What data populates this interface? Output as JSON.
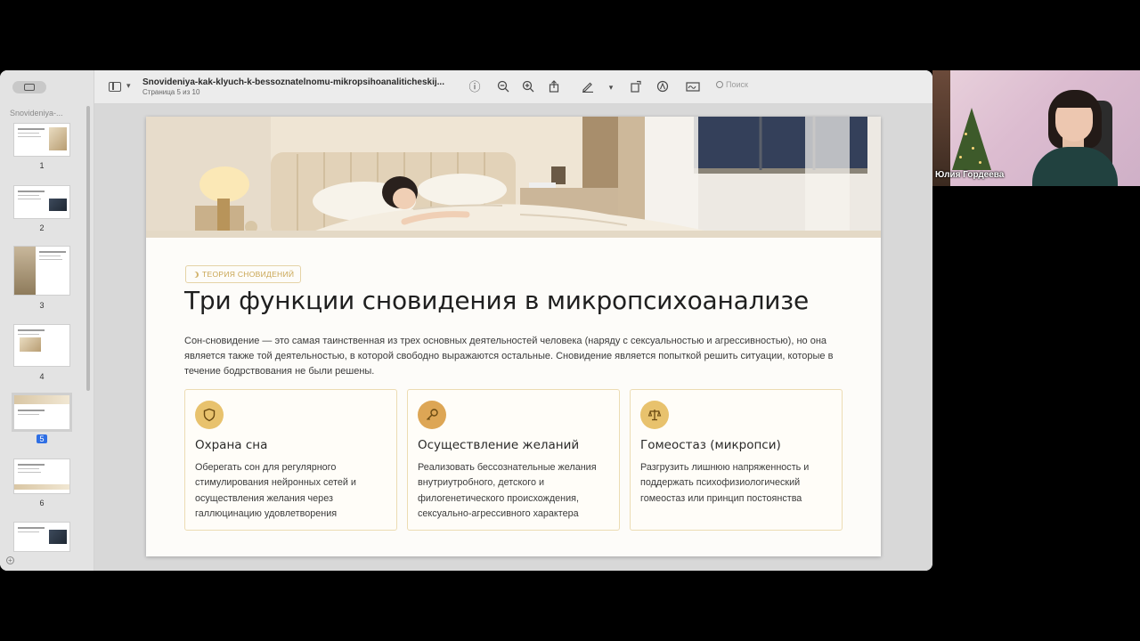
{
  "document": {
    "file_name": "Snovideniya-kak-klyuch-k-bessoznatelnomu-mikropsihoanaliticheskij...",
    "page_indicator": "Страница 5 из 10",
    "sidebar_title": "Snovideniya-..."
  },
  "toolbar": {
    "search_placeholder": "Поиск",
    "icons": [
      "sidebar-icon",
      "info-icon",
      "zoom-out-icon",
      "zoom-in-icon",
      "share-icon",
      "markup-pen-icon",
      "rotate-icon",
      "highlight-icon",
      "signature-icon",
      "search-icon"
    ]
  },
  "thumbnails": [
    {
      "page": "1"
    },
    {
      "page": "2"
    },
    {
      "page": "3"
    },
    {
      "page": "4"
    },
    {
      "page": "5",
      "current": true
    },
    {
      "page": "6"
    }
  ],
  "slide": {
    "tag": "ТЕОРИЯ СНОВИДЕНИЙ",
    "title": "Три функции сновидения в микропсихоанализе",
    "intro": "Сон-сновидение — это самая таинственная из трех основных деятельностей человека (наряду с сексуальностью и агрессивностью), но она является также той деятельностью, в которой свободно выражаются остальные. Сновидение является попыткой решить ситуации, которые в течение бодрствования не были решены.",
    "cards": [
      {
        "icon": "shield-icon",
        "title": "Охрана сна",
        "text": "Оберегать сон для регулярного стимулирования нейронных сетей и осуществления желания через галлюцинацию удовлетворения"
      },
      {
        "icon": "key-icon",
        "title": "Осуществление желаний",
        "text": "Реализовать бессознательные желания внутриутробного, детского и филогенетического происхождения, сексуально-агрессивного характера"
      },
      {
        "icon": "scales-icon",
        "title": "Гомеостаз (микропси)",
        "text": "Разгрузить лишнюю напряженность и поддержать психофизиологический гомеостаз или принцип постоянства"
      }
    ],
    "accent_color": "#e8c26d"
  },
  "participant": {
    "name": "Юлия Гордеева"
  }
}
